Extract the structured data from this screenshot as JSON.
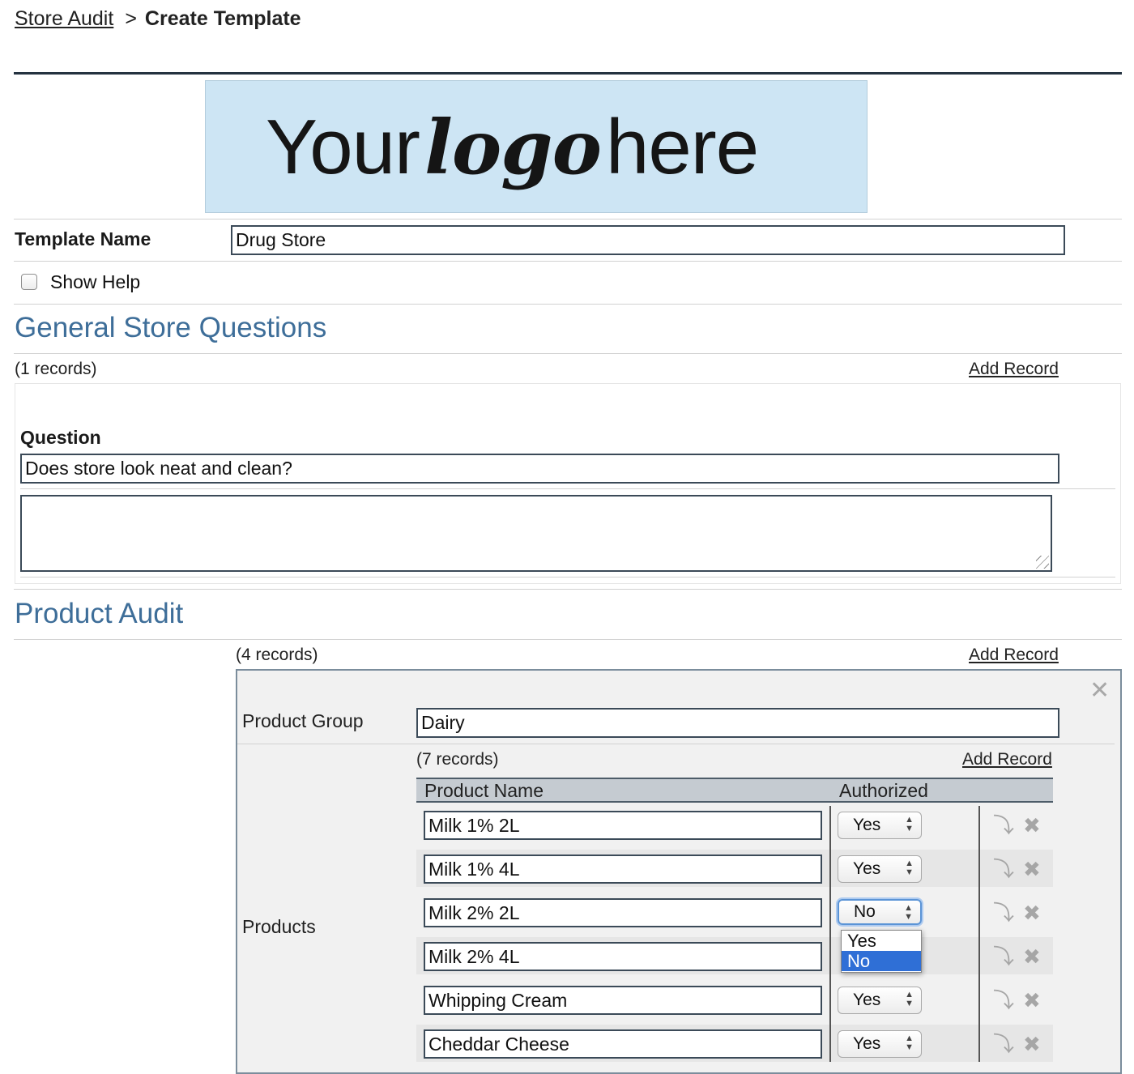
{
  "breadcrumb": {
    "parent": "Store Audit",
    "separator": ">",
    "current": "Create Template"
  },
  "logo": {
    "word1": "Your",
    "word2": "logo",
    "word3": "here"
  },
  "template": {
    "name_label": "Template Name",
    "name_value": "Drug Store"
  },
  "show_help": {
    "label": "Show Help",
    "checked": false
  },
  "general": {
    "title": "General Store Questions",
    "records": "(1 records)",
    "add_record": "Add Record",
    "question_label": "Question",
    "question_value": "Does store look neat and clean?",
    "notes_value": ""
  },
  "product_audit": {
    "title": "Product Audit",
    "records": "(4 records)",
    "add_record": "Add Record",
    "group_label": "Product Group",
    "group_value": "Dairy",
    "products_label": "Products",
    "products_records": "(7 records)",
    "products_add_record": "Add Record",
    "columns": {
      "name": "Product Name",
      "authorized": "Authorized"
    },
    "products": [
      {
        "name": "Milk 1% 2L",
        "authorized": "Yes"
      },
      {
        "name": "Milk 1% 4L",
        "authorized": "Yes"
      },
      {
        "name": "Milk 2% 2L",
        "authorized": "No"
      },
      {
        "name": "Milk 2% 4L",
        "authorized": ""
      },
      {
        "name": "Whipping Cream",
        "authorized": "Yes"
      },
      {
        "name": "Cheddar Cheese",
        "authorized": "Yes"
      }
    ],
    "dropdown_options": [
      "Yes",
      "No"
    ],
    "dropdown_selected": "No"
  },
  "icons": {
    "close": "close-icon",
    "move": "move-down-arrow-icon",
    "delete": "delete-x-icon",
    "select_arrows": "select-updown-icon"
  }
}
